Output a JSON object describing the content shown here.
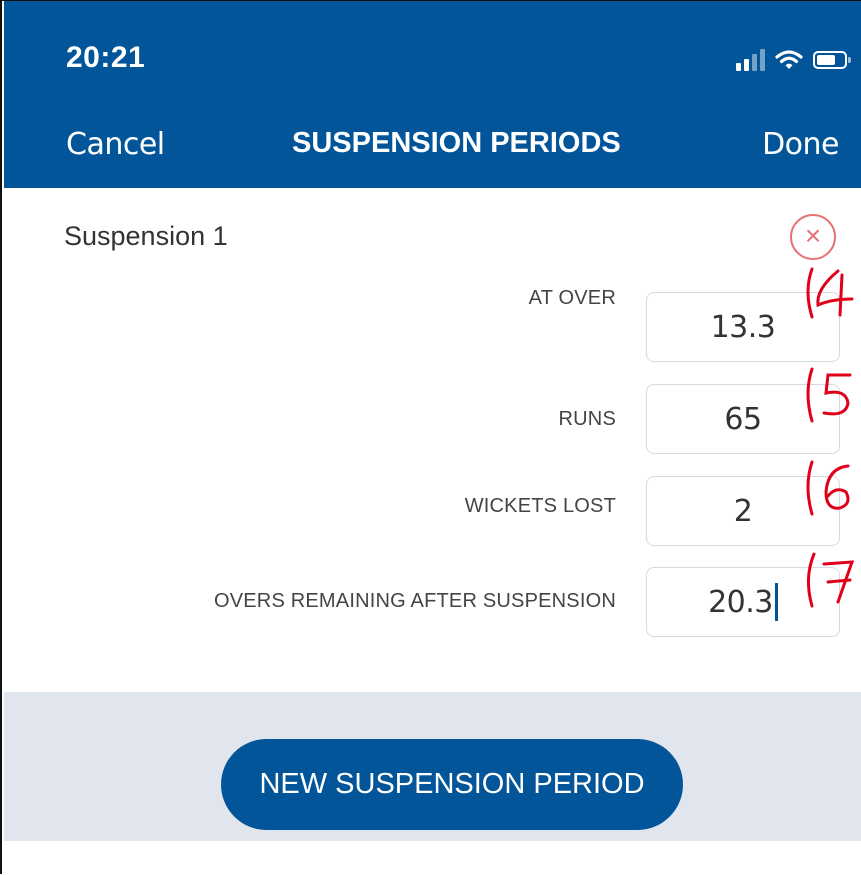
{
  "status_bar": {
    "time": "20:21",
    "signal_icon": "cellular-signal-icon",
    "wifi_icon": "wifi-icon",
    "battery_icon": "battery-icon"
  },
  "nav": {
    "cancel_label": "Cancel",
    "title": "SUSPENSION PERIODS",
    "done_label": "Done"
  },
  "suspension": {
    "title": "Suspension 1",
    "remove_symbol": "×",
    "fields": [
      {
        "label": "AT OVER",
        "value": "13.3",
        "annotation": "4"
      },
      {
        "label": "RUNS",
        "value": "65",
        "annotation": "5"
      },
      {
        "label": "WICKETS LOST",
        "value": "2",
        "annotation": "6"
      },
      {
        "label": "OVERS REMAINING AFTER SUSPENSION",
        "value": "20.3",
        "annotation": "7"
      }
    ]
  },
  "footer": {
    "new_button_label": "NEW SUSPENSION PERIOD"
  },
  "colors": {
    "primary": "#03559a",
    "remove": "#e57373",
    "annotation": "#e0001a",
    "footer_bg": "#e1e5ed"
  }
}
